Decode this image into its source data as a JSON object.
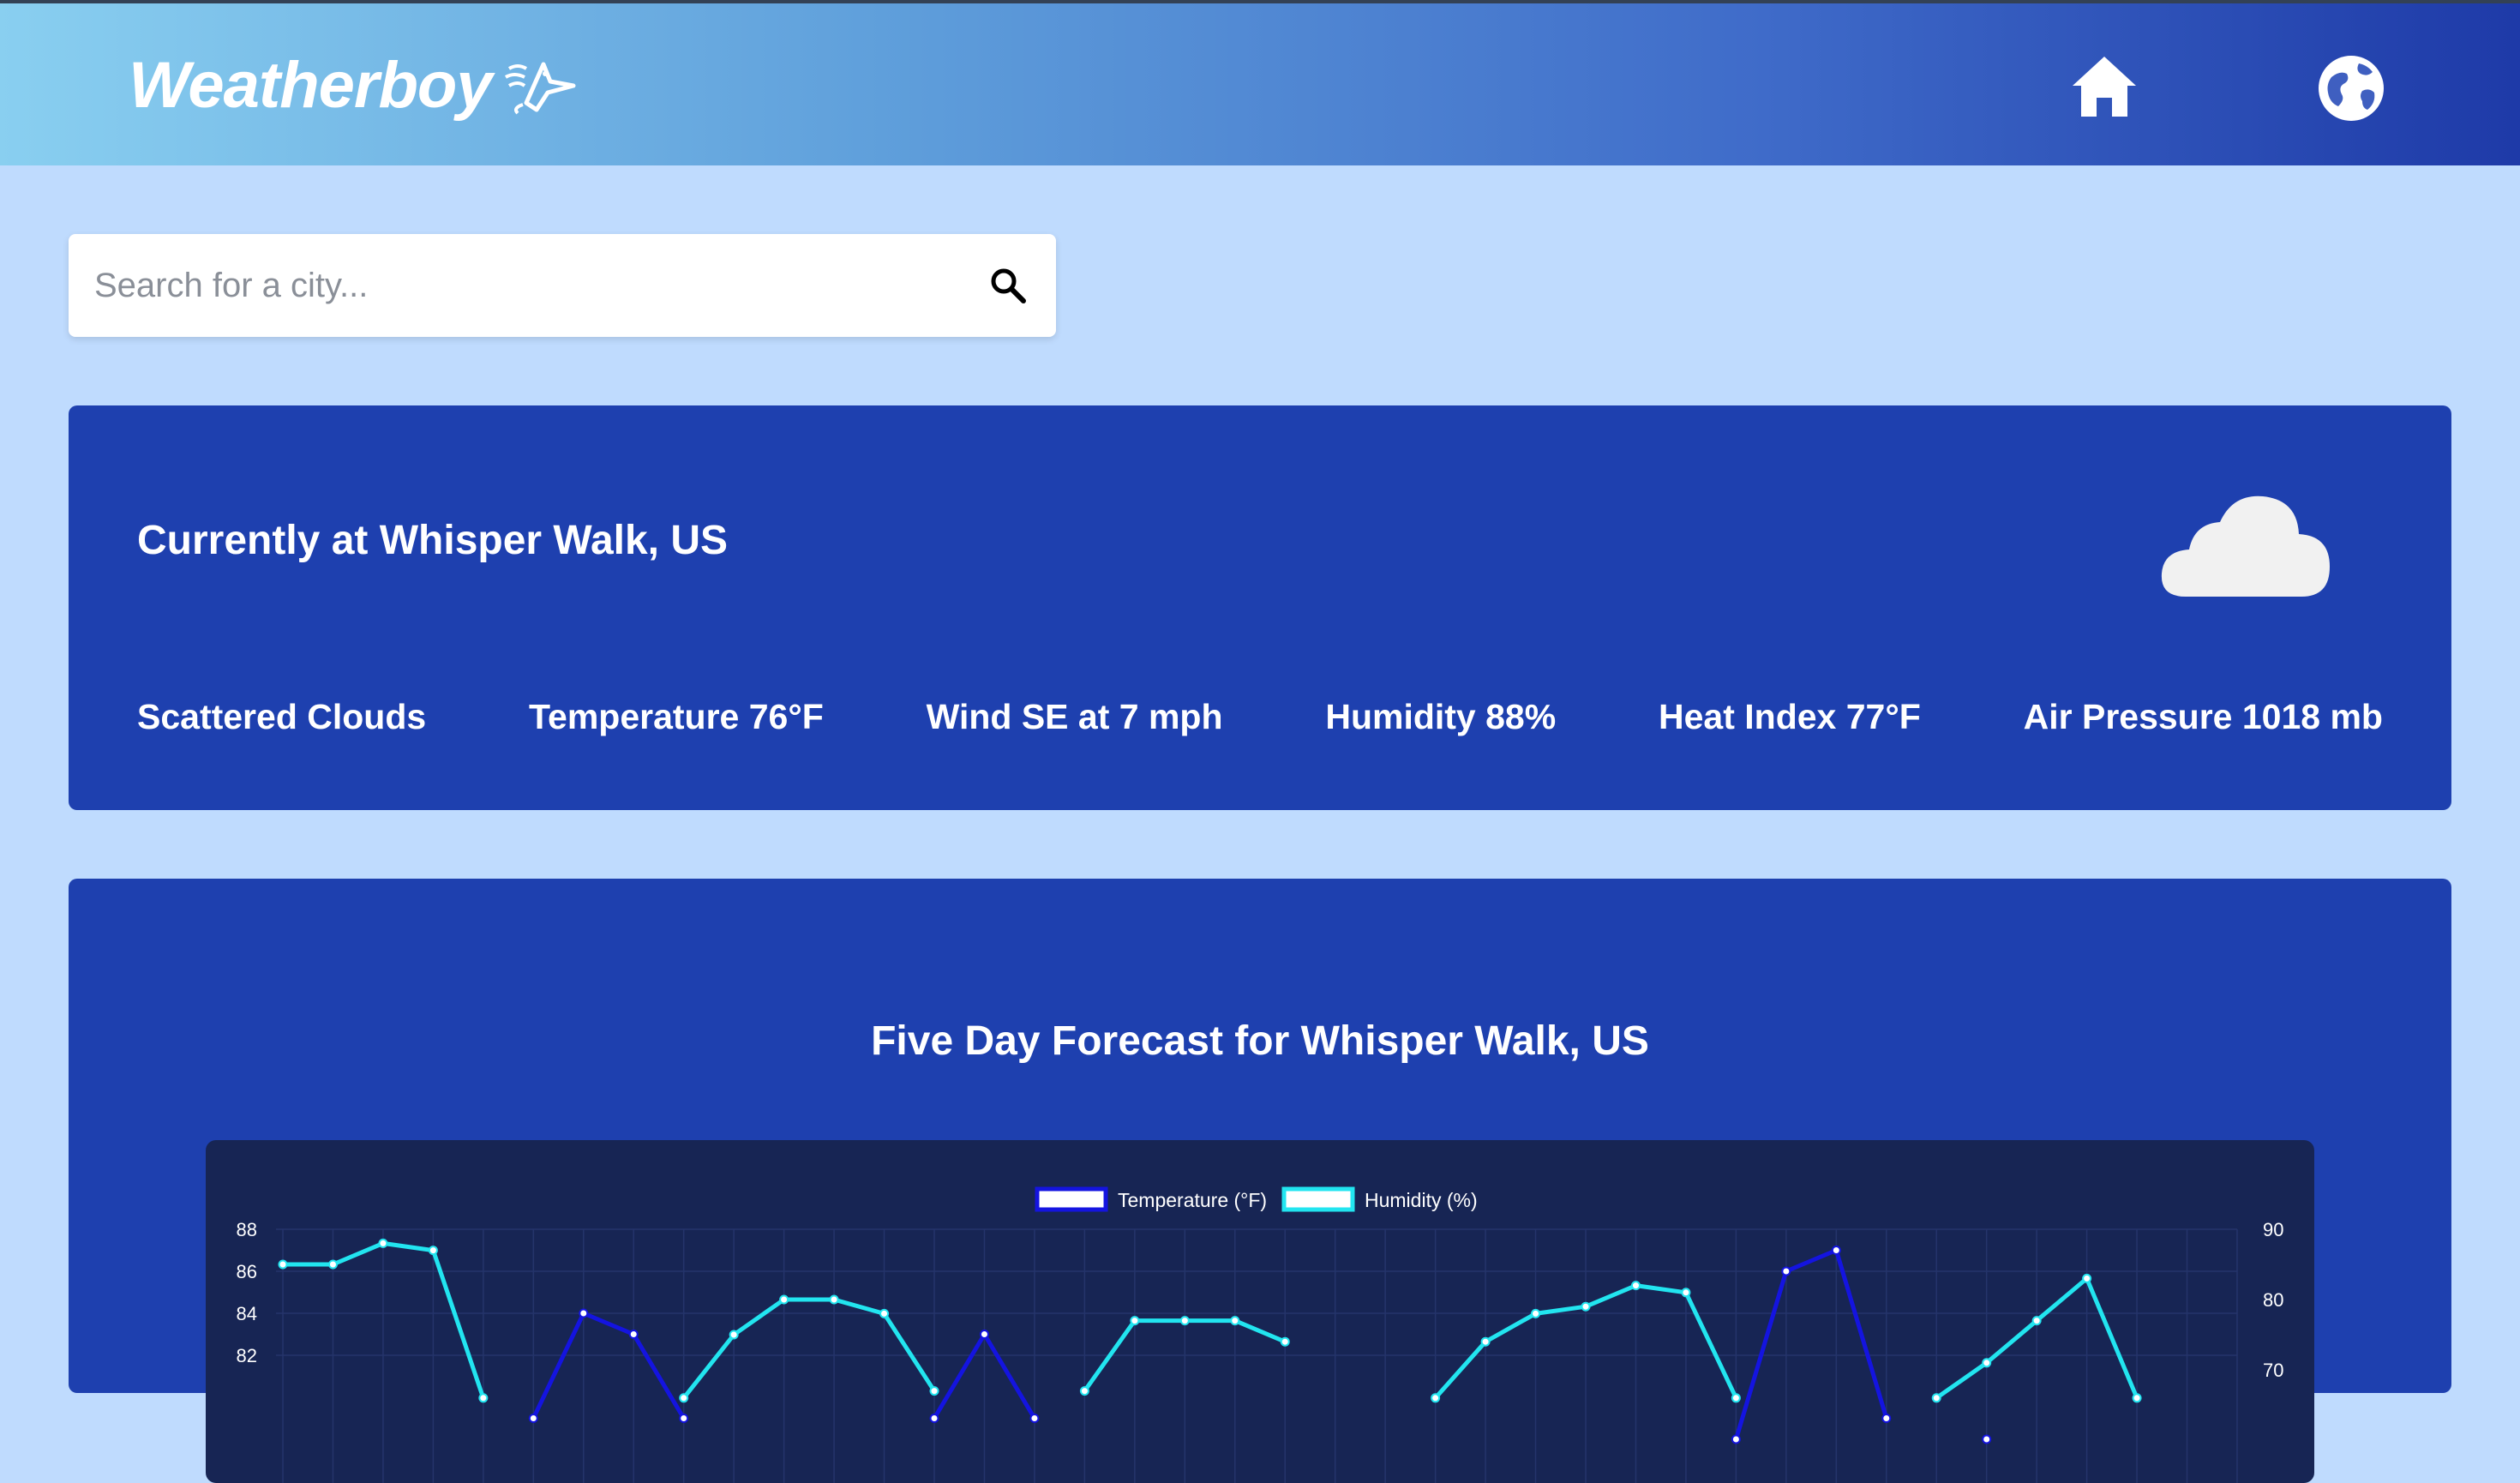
{
  "header": {
    "logo_text": "Weatherboy",
    "logo_icon": "wind-bird-icon",
    "nav": [
      {
        "icon": "home-icon"
      },
      {
        "icon": "globe-icon"
      }
    ]
  },
  "search": {
    "placeholder": "Search for a city...",
    "value": "",
    "icon": "search-icon"
  },
  "current": {
    "title": "Currently at Whisper Walk, US",
    "icon": "cloud-icon",
    "stats": {
      "condition": "Scattered Clouds",
      "temperature": "Temperature 76°F",
      "wind": "Wind SE at 7 mph",
      "humidity": "Humidity 88%",
      "heat_index": "Heat Index 77°F",
      "pressure": "Air Pressure 1018 mb"
    }
  },
  "forecast": {
    "title": "Five Day Forecast for Whisper Walk, US"
  },
  "colors": {
    "card": "#1e40af",
    "chart_bg": "#172554",
    "temperature_line": "#1414e0",
    "humidity_line": "#22e5f0",
    "page_bg": "#bfdbfe"
  },
  "chart_data": {
    "type": "line",
    "legend_position": "top-center",
    "grid": true,
    "x": [
      0,
      1,
      2,
      3,
      4,
      5,
      6,
      7,
      8,
      9,
      10,
      11,
      12,
      13,
      14,
      15,
      16,
      17,
      18,
      19,
      20,
      21,
      22,
      23,
      24,
      25,
      26,
      27,
      28,
      29,
      30,
      31,
      32,
      33,
      34,
      35,
      36,
      37,
      38,
      39
    ],
    "left_axis": {
      "ticks": [
        "88",
        "86",
        "84",
        "82"
      ],
      "visible_range": [
        82,
        88
      ]
    },
    "right_axis": {
      "ticks": [
        "90",
        "80",
        "70"
      ],
      "visible_range": [
        70,
        90
      ]
    },
    "series": [
      {
        "name": "Temperature (°F)",
        "axis": "left",
        "values": [
          null,
          null,
          null,
          null,
          null,
          79,
          84,
          83,
          79,
          null,
          null,
          null,
          null,
          79,
          83,
          79,
          null,
          null,
          null,
          null,
          null,
          null,
          null,
          null,
          null,
          null,
          null,
          null,
          null,
          78,
          86,
          87,
          79,
          null,
          78,
          null,
          null,
          null,
          null,
          null
        ]
      },
      {
        "name": "Humidity (%)",
        "axis": "right",
        "values": [
          85,
          85,
          88,
          87,
          66,
          null,
          null,
          null,
          66,
          75,
          80,
          80,
          78,
          67,
          null,
          null,
          67,
          77,
          77,
          77,
          74,
          null,
          null,
          66,
          74,
          78,
          79,
          82,
          81,
          66,
          null,
          null,
          null,
          66,
          71,
          77,
          83,
          66,
          null,
          null
        ]
      }
    ]
  }
}
